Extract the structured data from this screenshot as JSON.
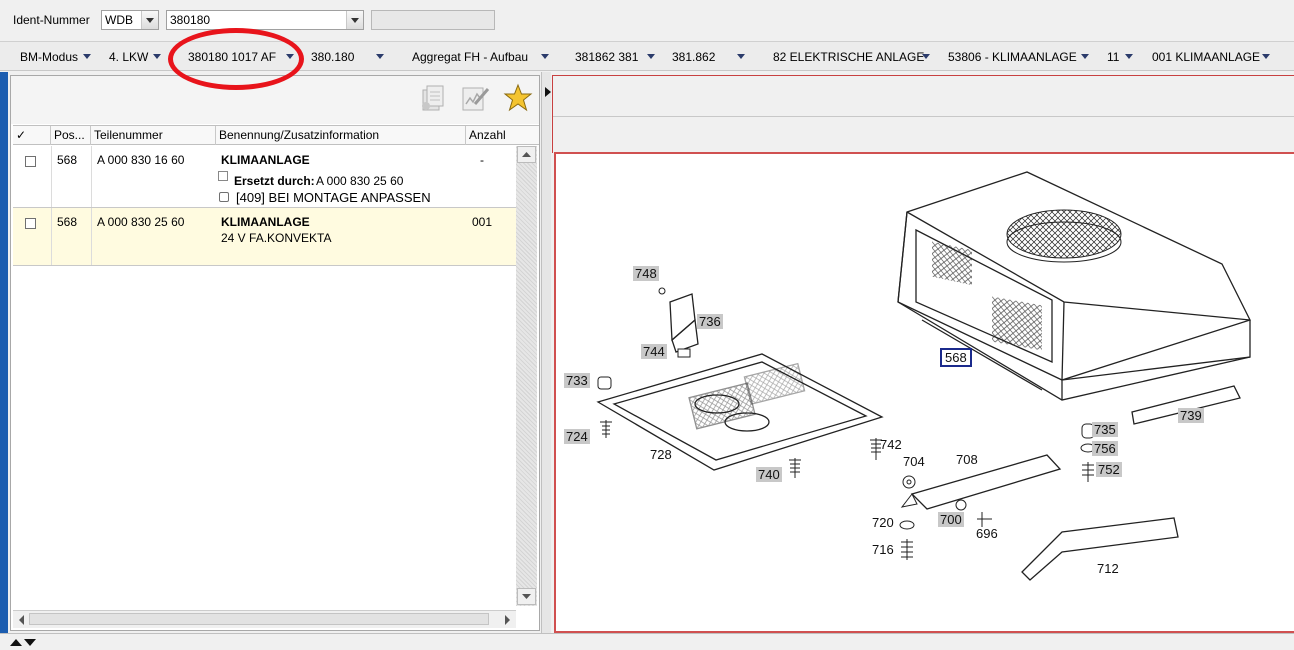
{
  "top": {
    "ident_label": "Ident-Nummer",
    "prefix_value": "WDB",
    "ident_value": "380180"
  },
  "breadcrumbs": [
    "BM-Modus",
    "4. LKW",
    "380180 1017 AF",
    "380.180",
    "Aggregat FH - Aufbau",
    "381862 381",
    "381.862",
    "82 ELEKTRISCHE ANLAGE",
    "53806 - KLIMAANLAGE",
    "11",
    "001 KLIMAANLAGE"
  ],
  "grid": {
    "headers": [
      "✓",
      "Pos...",
      "Teilenummer",
      "Benennung/Zusatzinformation",
      "Anzahl"
    ],
    "rows": [
      {
        "pos": "568",
        "part": "A 000 830 16 60",
        "name": "KLIMAANLAGE",
        "replaced_label": "Ersetzt durch:",
        "replaced_value": "A 000 830 25 60",
        "note": "[409] BEI MONTAGE ANPASSEN",
        "qty": "-"
      },
      {
        "pos": "568",
        "part": "A 000 830 25 60",
        "name": "KLIMAANLAGE",
        "info": "24 V FA.KONVEKTA",
        "qty": "001"
      }
    ]
  },
  "diagram": {
    "callouts": [
      "748",
      "736",
      "744",
      "733",
      "724",
      "728",
      "742",
      "740",
      "704",
      "708",
      "720",
      "700",
      "696",
      "716",
      "712",
      "735",
      "756",
      "752",
      "739",
      "568"
    ]
  },
  "colors": {
    "highlight_row": "#fffbe0",
    "annotation": "#e8141b",
    "crumb_arrow": "#2b3b6b"
  }
}
